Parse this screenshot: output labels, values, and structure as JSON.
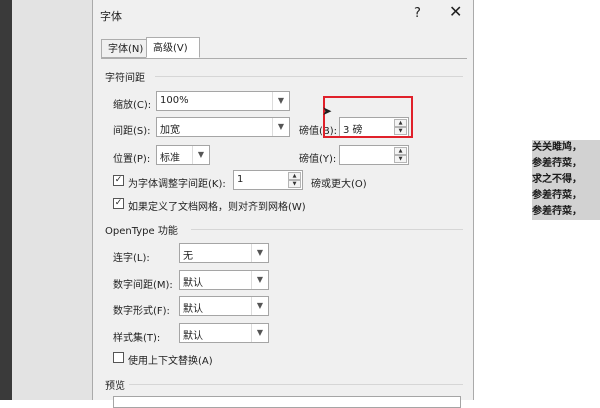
{
  "dialog": {
    "title": "字体",
    "help_label": "?",
    "close_label": "✕",
    "tabs": [
      {
        "label": "字体(N)",
        "active": false
      },
      {
        "label": "高级(V)",
        "active": true
      }
    ]
  },
  "char_spacing": {
    "group_label": "字符间距",
    "scale_label": "缩放(C):",
    "scale_value": "100%",
    "spacing_label": "间距(S):",
    "spacing_value": "加宽",
    "spacing_by_label": "磅值(B):",
    "spacing_by_value": "3 磅",
    "position_label": "位置(P):",
    "position_value": "标准",
    "position_by_label": "磅值(Y):",
    "position_by_value": "",
    "kerning_checked": true,
    "kerning_label": "为字体调整字间距(K):",
    "kerning_value": "1",
    "kerning_suffix": "磅或更大(O)",
    "snap_grid_checked": true,
    "snap_grid_label": "如果定义了文档网格，则对齐到网格(W)"
  },
  "opentype": {
    "group_label": "OpenType 功能",
    "ligatures_label": "连字(L):",
    "ligatures_value": "无",
    "num_spacing_label": "数字间距(M):",
    "num_spacing_value": "默认",
    "num_forms_label": "数字形式(F):",
    "num_forms_value": "默认",
    "stylistic_label": "样式集(T):",
    "stylistic_value": "默认",
    "contextual_checked": false,
    "contextual_label": "使用上下文替换(A)"
  },
  "preview": {
    "group_label": "预览"
  },
  "document": {
    "lines": [
      "关关雎鸠，",
      "参差荇菜，",
      "求之不得，",
      "参差荇菜，",
      "参差荇菜，"
    ]
  },
  "colors": {
    "highlight_box": "#e0202a",
    "dialog_bg": "#f0f0f0"
  },
  "icons": {
    "dropdown": "chevron-down-icon",
    "spin_up": "arrow-up-icon",
    "spin_down": "arrow-down-icon",
    "cursor": "mouse-pointer-icon"
  }
}
